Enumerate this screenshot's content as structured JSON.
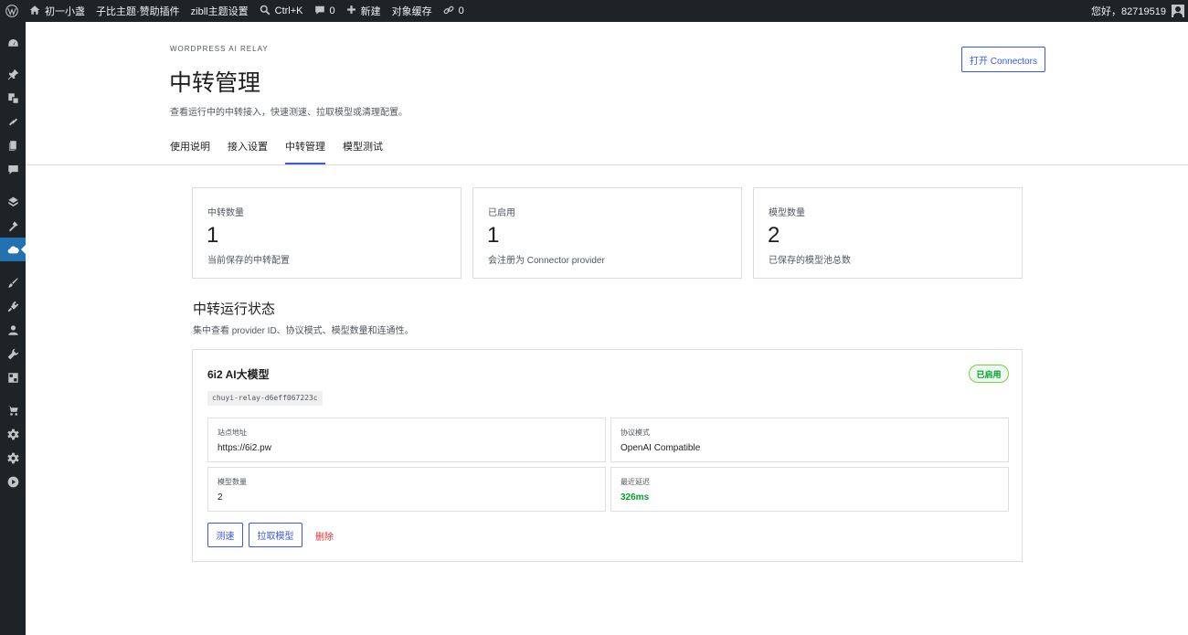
{
  "adminbar": {
    "site_name": "初一小盏",
    "items": [
      "子比主题·赞助插件",
      "zibll主题设置"
    ],
    "search_label": "Ctrl+K",
    "comments_count": "0",
    "new_label": "新建",
    "cache_label": "对象缓存",
    "links_count": "0",
    "greeting": "您好，82719519"
  },
  "header": {
    "eyebrow": "WORDPRESS AI RELAY",
    "title": "中转管理",
    "description": "查看运行中的中转接入，快速测速、拉取模型或清理配置。",
    "open_button": "打开 Connectors",
    "tabs": [
      {
        "label": "使用说明",
        "active": false
      },
      {
        "label": "接入设置",
        "active": false
      },
      {
        "label": "中转管理",
        "active": true
      },
      {
        "label": "模型测试",
        "active": false
      }
    ]
  },
  "stats": [
    {
      "label": "中转数量",
      "value": "1",
      "sub": "当前保存的中转配置"
    },
    {
      "label": "已启用",
      "value": "1",
      "sub": "会注册为 Connector provider"
    },
    {
      "label": "模型数量",
      "value": "2",
      "sub": "已保存的模型池总数"
    }
  ],
  "section": {
    "title": "中转运行状态",
    "description": "集中查看 provider ID、协议模式、模型数量和连通性。"
  },
  "relay": {
    "name": "6i2 AI大模型",
    "status": "已启用",
    "id": "chuyi-relay-d6eff067223c",
    "fields": [
      {
        "label": "站点地址",
        "value": "https://6i2.pw"
      },
      {
        "label": "协议模式",
        "value": "OpenAI Compatible"
      },
      {
        "label": "模型数量",
        "value": "2"
      },
      {
        "label": "最近延迟",
        "value": "326ms"
      }
    ],
    "actions": {
      "speed_test": "测速",
      "fetch_models": "拉取模型",
      "delete": "删除"
    }
  },
  "colors": {
    "accent": "#3858e9",
    "wp_blue": "#2271b1",
    "success": "#00a32a",
    "danger": "#d63638",
    "adminbar_bg": "#1d2327"
  }
}
